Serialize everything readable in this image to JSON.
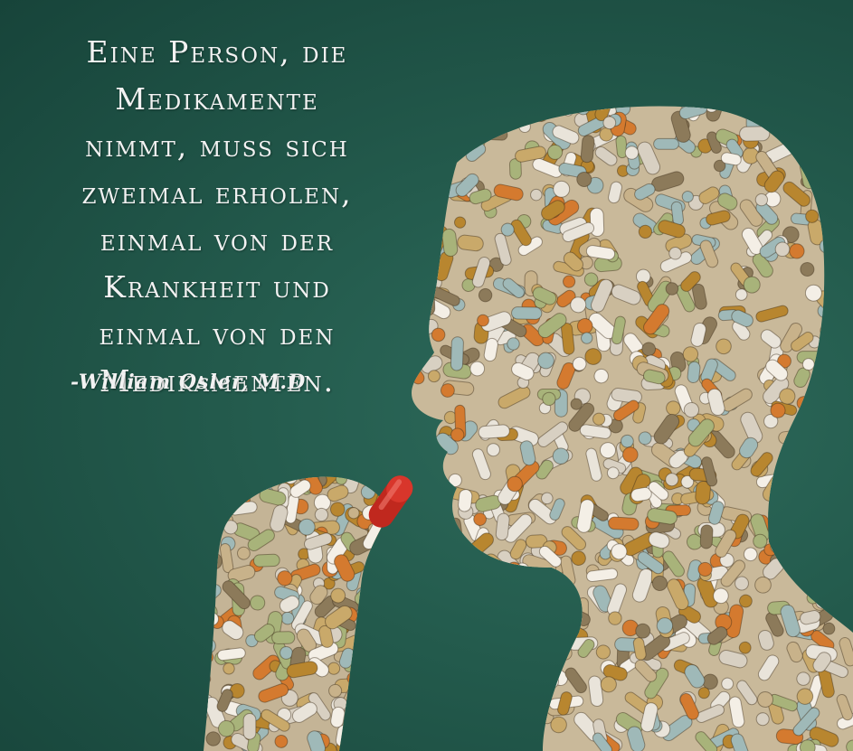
{
  "quote": {
    "lines": [
      "Eine Person, die",
      "Medikamente",
      "nimmt, muss sich",
      "zweimal erholen,",
      "einmal von der",
      "Krankheit und",
      "einmal von den",
      "Medikamenten."
    ],
    "author": "-William Osler, M.D"
  },
  "colors": {
    "background": "#235a4c",
    "text": "#f2f2f2",
    "pill_palette": [
      "#e9e4da",
      "#d8d0c2",
      "#c9a96a",
      "#b8862f",
      "#d47a2f",
      "#a8b37a",
      "#9fb9b8",
      "#f4efe6",
      "#8c7a5a",
      "#c8b28a"
    ],
    "red_capsule": "#c0281e"
  }
}
